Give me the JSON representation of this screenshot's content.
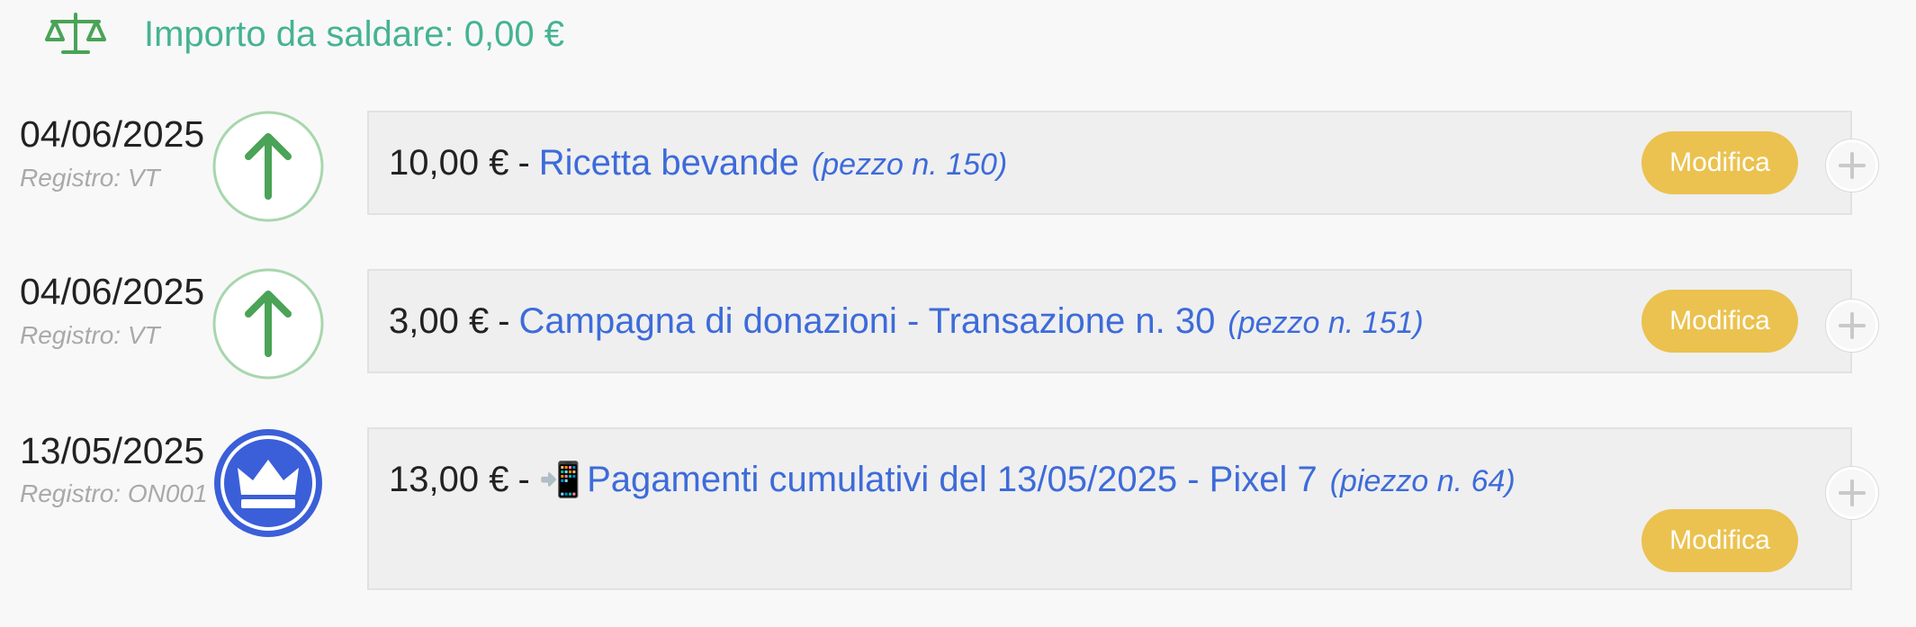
{
  "balance": {
    "icon": "scale-icon",
    "text": "Importo da saldare: 0,00 €"
  },
  "colors": {
    "balance_text": "#45b392",
    "link": "#3d6bd9",
    "edit_button": "#ebc24f",
    "income_icon": "#4aa356",
    "crown_icon_bg": "#3b5fd8"
  },
  "entries": [
    {
      "date": "04/06/2025",
      "register": "Registro: VT",
      "icon": "arrow-up-icon",
      "amount": "10,00 €",
      "separator": "-",
      "description": "Ricetta bevande",
      "piece": "(pezzo n. 150)",
      "edit_label": "Modifica",
      "add_icon": "plus-icon"
    },
    {
      "date": "04/06/2025",
      "register": "Registro: VT",
      "icon": "arrow-up-icon",
      "amount": "3,00 €",
      "separator": "-",
      "description": "Campagna di donazioni - Transazione n. 30",
      "piece": "(pezzo n. 151)",
      "edit_label": "Modifica",
      "add_icon": "plus-icon"
    },
    {
      "date": "13/05/2025",
      "register": "Registro: ON001",
      "icon": "crown-icon",
      "amount": "13,00 €",
      "separator": "-",
      "description_icon": "📲",
      "description": "Pagamenti cumulativi del 13/05/2025 - Pixel 7",
      "piece": "(piezzo n. 64)",
      "edit_label": "Modifica",
      "add_icon": "plus-icon"
    }
  ]
}
